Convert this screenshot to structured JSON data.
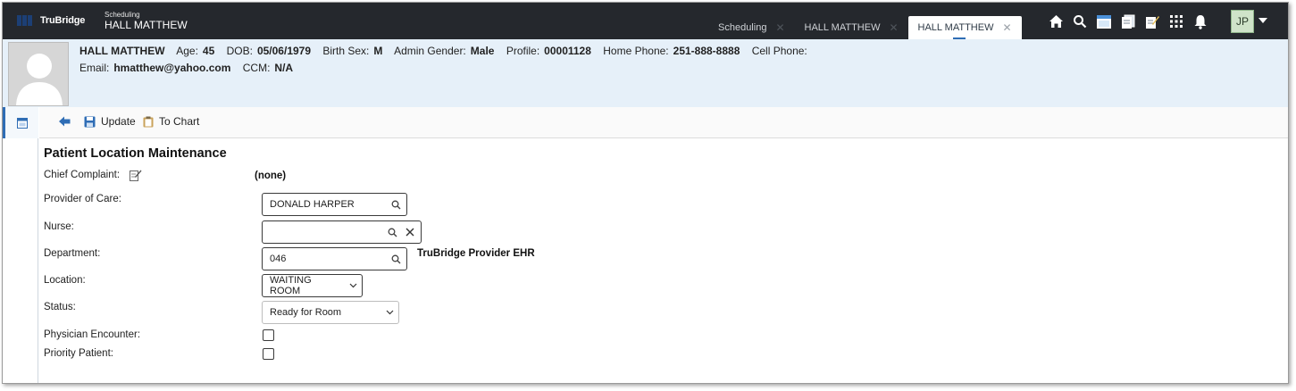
{
  "app": {
    "brand": "TruBridge",
    "module_label": "Scheduling",
    "module_title": "HALL MATTHEW"
  },
  "tabs": [
    {
      "label": "Scheduling",
      "active": false
    },
    {
      "label": "HALL MATTHEW",
      "active": false
    },
    {
      "label": "HALL MATTHEW",
      "active": true
    }
  ],
  "topbar_icons": [
    "home-icon",
    "search-icon",
    "calendar-icon",
    "documents-icon",
    "note-edit-icon",
    "apps-grid-icon",
    "bell-icon"
  ],
  "user": {
    "initials": "JP"
  },
  "patient": {
    "name": "HALL MATTHEW",
    "age_label": "Age:",
    "age": "45",
    "dob_label": "DOB:",
    "dob": "05/06/1979",
    "sex_label": "Birth Sex:",
    "sex": "M",
    "gender_label": "Admin Gender:",
    "gender": "Male",
    "profile_label": "Profile:",
    "profile": "00001128",
    "home_phone_label": "Home Phone:",
    "home_phone": "251-888-8888",
    "cell_phone_label": "Cell Phone:",
    "cell_phone": "",
    "email_label": "Email:",
    "email": "hmatthew@yahoo.com",
    "ccm_label": "CCM:",
    "ccm": "N/A"
  },
  "toolbar": {
    "back_icon": "back-arrow-icon",
    "update_label": "Update",
    "to_chart_label": "To Chart"
  },
  "form": {
    "title": "Patient Location Maintenance",
    "chief_complaint_label": "Chief Complaint:",
    "chief_complaint_value": "(none)",
    "provider_label": "Provider of Care:",
    "provider_value": "DONALD HARPER",
    "nurse_label": "Nurse:",
    "nurse_value": "",
    "department_label": "Department:",
    "department_value": "046",
    "department_name": "TruBridge Provider EHR",
    "location_label": "Location:",
    "location_value": "WAITING ROOM",
    "status_label": "Status:",
    "status_value": "Ready for Room",
    "physician_encounter_label": "Physician Encounter:",
    "physician_encounter_checked": false,
    "priority_patient_label": "Priority Patient:",
    "priority_patient_checked": false
  },
  "colors": {
    "topbar_bg": "#25282d",
    "banner_bg": "#e6f0f9",
    "accent": "#2f6db5",
    "avatar_bg": "#cfe3c9"
  }
}
